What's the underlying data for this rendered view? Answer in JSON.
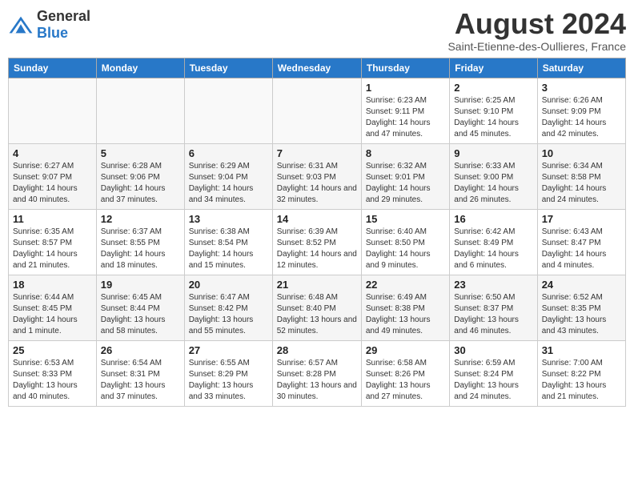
{
  "header": {
    "logo_general": "General",
    "logo_blue": "Blue",
    "month_title": "August 2024",
    "subtitle": "Saint-Etienne-des-Oullieres, France"
  },
  "days_of_week": [
    "Sunday",
    "Monday",
    "Tuesday",
    "Wednesday",
    "Thursday",
    "Friday",
    "Saturday"
  ],
  "weeks": [
    [
      {
        "day": "",
        "info": ""
      },
      {
        "day": "",
        "info": ""
      },
      {
        "day": "",
        "info": ""
      },
      {
        "day": "",
        "info": ""
      },
      {
        "day": "1",
        "info": "Sunrise: 6:23 AM\nSunset: 9:11 PM\nDaylight: 14 hours and 47 minutes."
      },
      {
        "day": "2",
        "info": "Sunrise: 6:25 AM\nSunset: 9:10 PM\nDaylight: 14 hours and 45 minutes."
      },
      {
        "day": "3",
        "info": "Sunrise: 6:26 AM\nSunset: 9:09 PM\nDaylight: 14 hours and 42 minutes."
      }
    ],
    [
      {
        "day": "4",
        "info": "Sunrise: 6:27 AM\nSunset: 9:07 PM\nDaylight: 14 hours and 40 minutes."
      },
      {
        "day": "5",
        "info": "Sunrise: 6:28 AM\nSunset: 9:06 PM\nDaylight: 14 hours and 37 minutes."
      },
      {
        "day": "6",
        "info": "Sunrise: 6:29 AM\nSunset: 9:04 PM\nDaylight: 14 hours and 34 minutes."
      },
      {
        "day": "7",
        "info": "Sunrise: 6:31 AM\nSunset: 9:03 PM\nDaylight: 14 hours and 32 minutes."
      },
      {
        "day": "8",
        "info": "Sunrise: 6:32 AM\nSunset: 9:01 PM\nDaylight: 14 hours and 29 minutes."
      },
      {
        "day": "9",
        "info": "Sunrise: 6:33 AM\nSunset: 9:00 PM\nDaylight: 14 hours and 26 minutes."
      },
      {
        "day": "10",
        "info": "Sunrise: 6:34 AM\nSunset: 8:58 PM\nDaylight: 14 hours and 24 minutes."
      }
    ],
    [
      {
        "day": "11",
        "info": "Sunrise: 6:35 AM\nSunset: 8:57 PM\nDaylight: 14 hours and 21 minutes."
      },
      {
        "day": "12",
        "info": "Sunrise: 6:37 AM\nSunset: 8:55 PM\nDaylight: 14 hours and 18 minutes."
      },
      {
        "day": "13",
        "info": "Sunrise: 6:38 AM\nSunset: 8:54 PM\nDaylight: 14 hours and 15 minutes."
      },
      {
        "day": "14",
        "info": "Sunrise: 6:39 AM\nSunset: 8:52 PM\nDaylight: 14 hours and 12 minutes."
      },
      {
        "day": "15",
        "info": "Sunrise: 6:40 AM\nSunset: 8:50 PM\nDaylight: 14 hours and 9 minutes."
      },
      {
        "day": "16",
        "info": "Sunrise: 6:42 AM\nSunset: 8:49 PM\nDaylight: 14 hours and 6 minutes."
      },
      {
        "day": "17",
        "info": "Sunrise: 6:43 AM\nSunset: 8:47 PM\nDaylight: 14 hours and 4 minutes."
      }
    ],
    [
      {
        "day": "18",
        "info": "Sunrise: 6:44 AM\nSunset: 8:45 PM\nDaylight: 14 hours and 1 minute."
      },
      {
        "day": "19",
        "info": "Sunrise: 6:45 AM\nSunset: 8:44 PM\nDaylight: 13 hours and 58 minutes."
      },
      {
        "day": "20",
        "info": "Sunrise: 6:47 AM\nSunset: 8:42 PM\nDaylight: 13 hours and 55 minutes."
      },
      {
        "day": "21",
        "info": "Sunrise: 6:48 AM\nSunset: 8:40 PM\nDaylight: 13 hours and 52 minutes."
      },
      {
        "day": "22",
        "info": "Sunrise: 6:49 AM\nSunset: 8:38 PM\nDaylight: 13 hours and 49 minutes."
      },
      {
        "day": "23",
        "info": "Sunrise: 6:50 AM\nSunset: 8:37 PM\nDaylight: 13 hours and 46 minutes."
      },
      {
        "day": "24",
        "info": "Sunrise: 6:52 AM\nSunset: 8:35 PM\nDaylight: 13 hours and 43 minutes."
      }
    ],
    [
      {
        "day": "25",
        "info": "Sunrise: 6:53 AM\nSunset: 8:33 PM\nDaylight: 13 hours and 40 minutes."
      },
      {
        "day": "26",
        "info": "Sunrise: 6:54 AM\nSunset: 8:31 PM\nDaylight: 13 hours and 37 minutes."
      },
      {
        "day": "27",
        "info": "Sunrise: 6:55 AM\nSunset: 8:29 PM\nDaylight: 13 hours and 33 minutes."
      },
      {
        "day": "28",
        "info": "Sunrise: 6:57 AM\nSunset: 8:28 PM\nDaylight: 13 hours and 30 minutes."
      },
      {
        "day": "29",
        "info": "Sunrise: 6:58 AM\nSunset: 8:26 PM\nDaylight: 13 hours and 27 minutes."
      },
      {
        "day": "30",
        "info": "Sunrise: 6:59 AM\nSunset: 8:24 PM\nDaylight: 13 hours and 24 minutes."
      },
      {
        "day": "31",
        "info": "Sunrise: 7:00 AM\nSunset: 8:22 PM\nDaylight: 13 hours and 21 minutes."
      }
    ]
  ]
}
